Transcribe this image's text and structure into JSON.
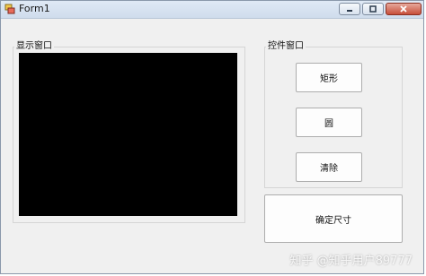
{
  "window": {
    "title": "Form1"
  },
  "display_group": {
    "label": "显示窗口"
  },
  "control_group": {
    "label": "控件窗口",
    "buttons": {
      "rectangle": "矩形",
      "circle": "圆",
      "clear": "清除"
    }
  },
  "confirm_size_button": "确定尺寸",
  "watermark": "知乎 @知乎用户89777",
  "colors": {
    "display_background": "#000000",
    "form_background": "#f0f0f0"
  },
  "icons": [
    "app-icon",
    "minimize-icon",
    "maximize-icon",
    "close-icon"
  ]
}
